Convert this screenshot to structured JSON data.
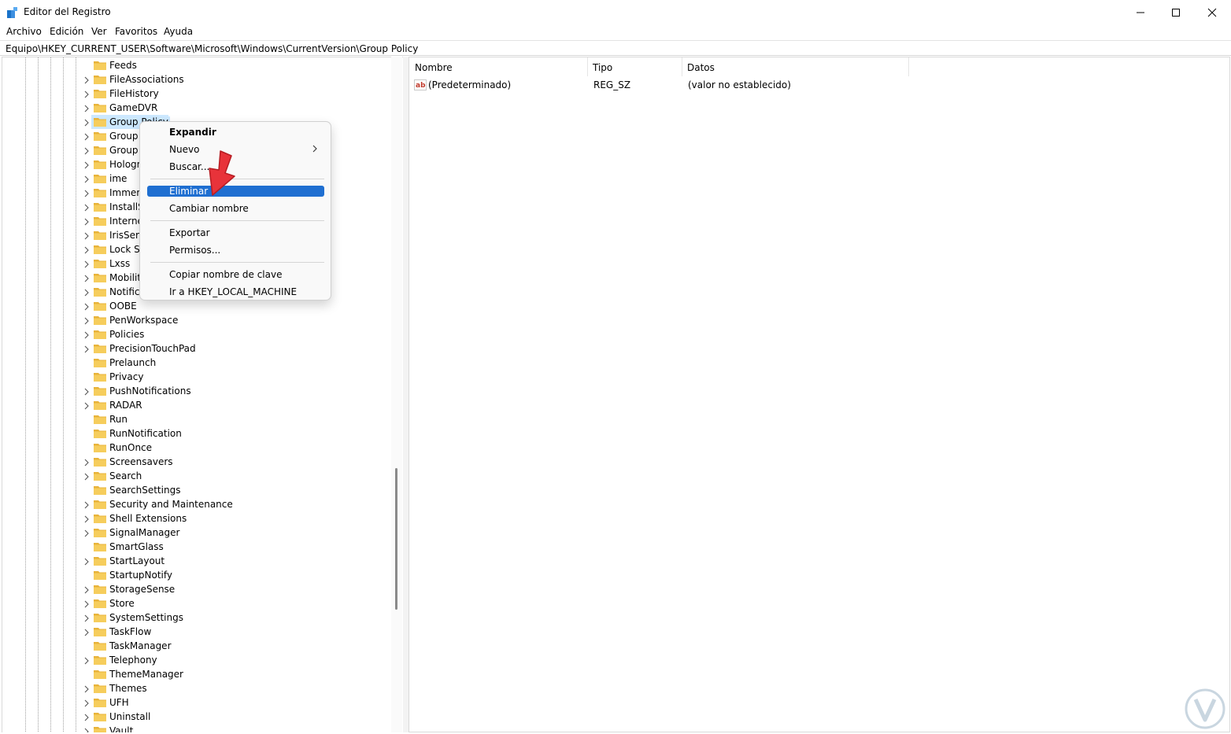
{
  "window": {
    "title": "Editor del Registro",
    "icon": "regedit-icon"
  },
  "menu": {
    "items": [
      "Archivo",
      "Edición",
      "Ver",
      "Favoritos",
      "Ayuda"
    ]
  },
  "address": {
    "path": "Equipo\\HKEY_CURRENT_USER\\Software\\Microsoft\\Windows\\CurrentVersion\\Group Policy"
  },
  "tree": {
    "items": [
      {
        "label": "Feeds",
        "expandable": false
      },
      {
        "label": "FileAssociations",
        "expandable": true
      },
      {
        "label": "FileHistory",
        "expandable": true
      },
      {
        "label": "GameDVR",
        "expandable": true
      },
      {
        "label": "Group Policy",
        "expandable": true,
        "selected": true
      },
      {
        "label": "Group Policy Editor",
        "expandable": true
      },
      {
        "label": "Group Policy Objects",
        "expandable": true
      },
      {
        "label": "Holographic",
        "expandable": true
      },
      {
        "label": "ime",
        "expandable": true
      },
      {
        "label": "ImmersiveShell",
        "expandable": true
      },
      {
        "label": "InstallService",
        "expandable": true
      },
      {
        "label": "Internet Settings",
        "expandable": true
      },
      {
        "label": "IrisService",
        "expandable": true
      },
      {
        "label": "Lock Screen",
        "expandable": true
      },
      {
        "label": "Lxss",
        "expandable": true
      },
      {
        "label": "Mobility",
        "expandable": true
      },
      {
        "label": "Notifications",
        "expandable": true
      },
      {
        "label": "OOBE",
        "expandable": true
      },
      {
        "label": "PenWorkspace",
        "expandable": true
      },
      {
        "label": "Policies",
        "expandable": true
      },
      {
        "label": "PrecisionTouchPad",
        "expandable": true
      },
      {
        "label": "Prelaunch",
        "expandable": false
      },
      {
        "label": "Privacy",
        "expandable": false
      },
      {
        "label": "PushNotifications",
        "expandable": true
      },
      {
        "label": "RADAR",
        "expandable": true
      },
      {
        "label": "Run",
        "expandable": false
      },
      {
        "label": "RunNotification",
        "expandable": false
      },
      {
        "label": "RunOnce",
        "expandable": false
      },
      {
        "label": "Screensavers",
        "expandable": true
      },
      {
        "label": "Search",
        "expandable": true
      },
      {
        "label": "SearchSettings",
        "expandable": false
      },
      {
        "label": "Security and Maintenance",
        "expandable": true
      },
      {
        "label": "Shell Extensions",
        "expandable": true
      },
      {
        "label": "SignalManager",
        "expandable": true
      },
      {
        "label": "SmartGlass",
        "expandable": false
      },
      {
        "label": "StartLayout",
        "expandable": true
      },
      {
        "label": "StartupNotify",
        "expandable": false
      },
      {
        "label": "StorageSense",
        "expandable": true
      },
      {
        "label": "Store",
        "expandable": true
      },
      {
        "label": "SystemSettings",
        "expandable": true
      },
      {
        "label": "TaskFlow",
        "expandable": true
      },
      {
        "label": "TaskManager",
        "expandable": false
      },
      {
        "label": "Telephony",
        "expandable": true
      },
      {
        "label": "ThemeManager",
        "expandable": false
      },
      {
        "label": "Themes",
        "expandable": true
      },
      {
        "label": "UFH",
        "expandable": true
      },
      {
        "label": "Uninstall",
        "expandable": true
      },
      {
        "label": "Vault",
        "expandable": true
      }
    ]
  },
  "list": {
    "columns": [
      "Nombre",
      "Tipo",
      "Datos"
    ],
    "rows": [
      {
        "name": "(Predeterminado)",
        "type": "REG_SZ",
        "data": "(valor no establecido)",
        "icon": "string-value-icon"
      }
    ]
  },
  "context_menu": {
    "items": [
      {
        "label": "Expandir",
        "bold": true
      },
      {
        "label": "Nuevo",
        "submenu": true
      },
      {
        "label": "Buscar..."
      },
      {
        "separator": true
      },
      {
        "label": "Eliminar",
        "highlighted": true
      },
      {
        "label": "Cambiar nombre"
      },
      {
        "separator": true
      },
      {
        "label": "Exportar"
      },
      {
        "label": "Permisos..."
      },
      {
        "separator": true
      },
      {
        "label": "Copiar nombre de clave"
      },
      {
        "label": "Ir a HKEY_LOCAL_MACHINE"
      }
    ]
  },
  "colors": {
    "highlight": "#1f6fd1",
    "selection": "#cce8ff",
    "folder": "#f2c14e",
    "pointer": "#e8333a"
  }
}
